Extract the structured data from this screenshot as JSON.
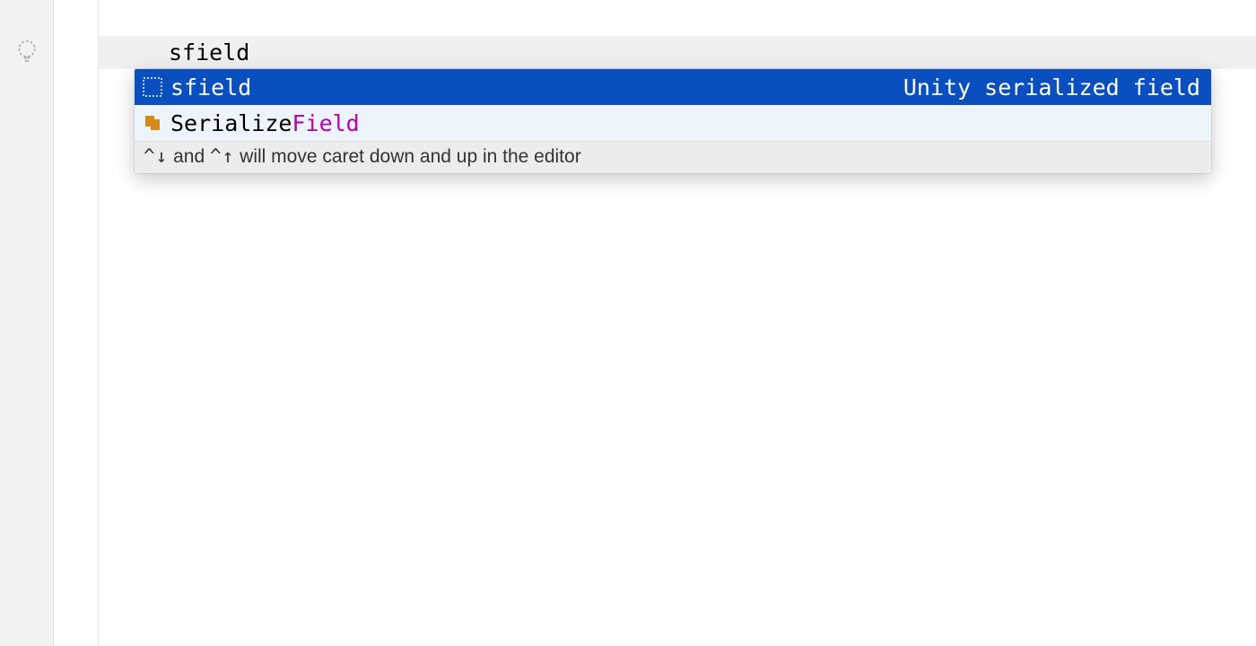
{
  "editor": {
    "typed_text": "sfield"
  },
  "completion": {
    "items": [
      {
        "icon": "template-icon",
        "label": "sfield",
        "description": "Unity serialized field",
        "selected": true
      },
      {
        "icon": "type-icon",
        "label_pre": "Serialize",
        "label_hi": "Field",
        "description": "",
        "selected": false
      }
    ],
    "hint_key1": "^↓",
    "hint_mid": " and ",
    "hint_key2": "^↑",
    "hint_rest": " will move caret down and up in the editor"
  }
}
